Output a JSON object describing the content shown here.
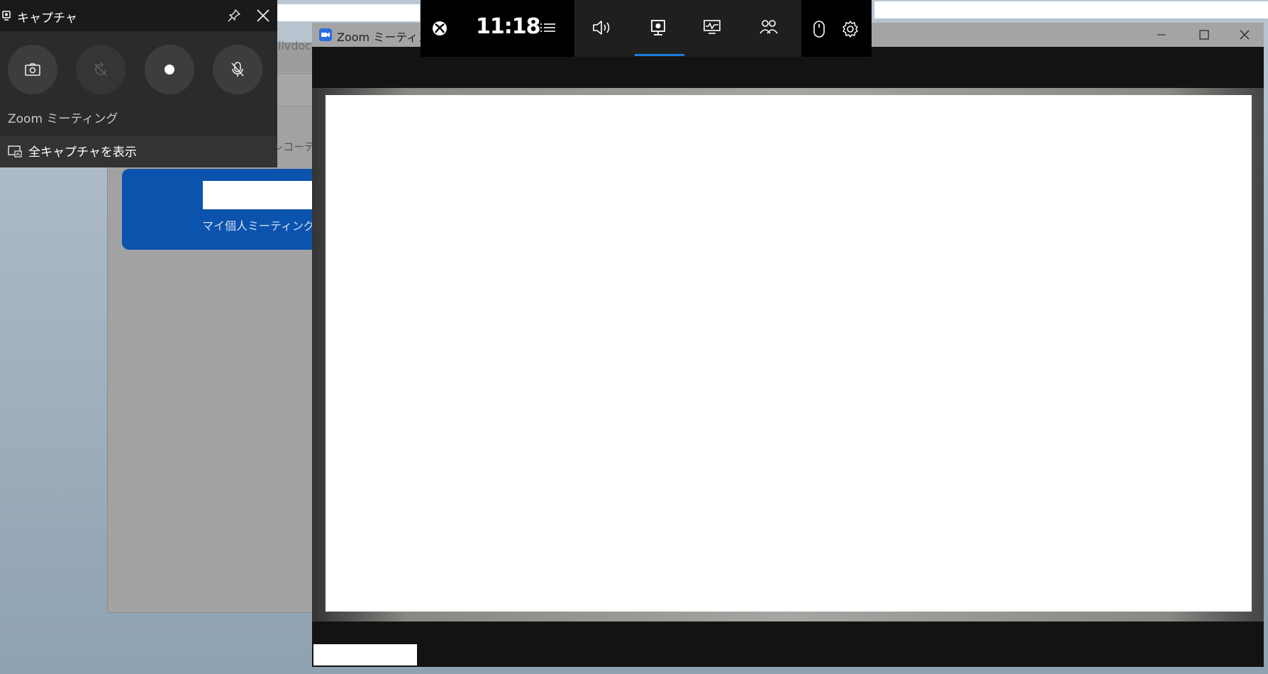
{
  "background_window": {
    "partial_title": "iivdoc",
    "recording_label": "レコーディ",
    "personal_meeting_id_label": "マイ個人ミーティングID(I"
  },
  "capture_widget": {
    "title": "キャプチャ",
    "buttons": [
      {
        "name": "screenshot",
        "icon": "camera-icon"
      },
      {
        "name": "record-last-30s",
        "icon": "history-off-icon"
      },
      {
        "name": "start-recording",
        "icon": "record-dot-icon"
      },
      {
        "name": "mic-toggle",
        "icon": "mic-off-icon"
      }
    ],
    "app_name": "Zoom ミーティング",
    "show_all_label": "全キャプチャを表示"
  },
  "zoom_window": {
    "title": "Zoom ミーティング",
    "controls": [
      "minimize",
      "maximize",
      "close"
    ]
  },
  "gamebar": {
    "time": "11:18",
    "widgets": [
      "audio-icon",
      "capture-icon",
      "performance-icon",
      "xbox-social-icon"
    ],
    "active_widget": "capture-icon"
  },
  "colors": {
    "accent_blue": "#1b7fdc",
    "meeting_card": "#0b53ad",
    "capture_bg": "#2b2b2b"
  }
}
